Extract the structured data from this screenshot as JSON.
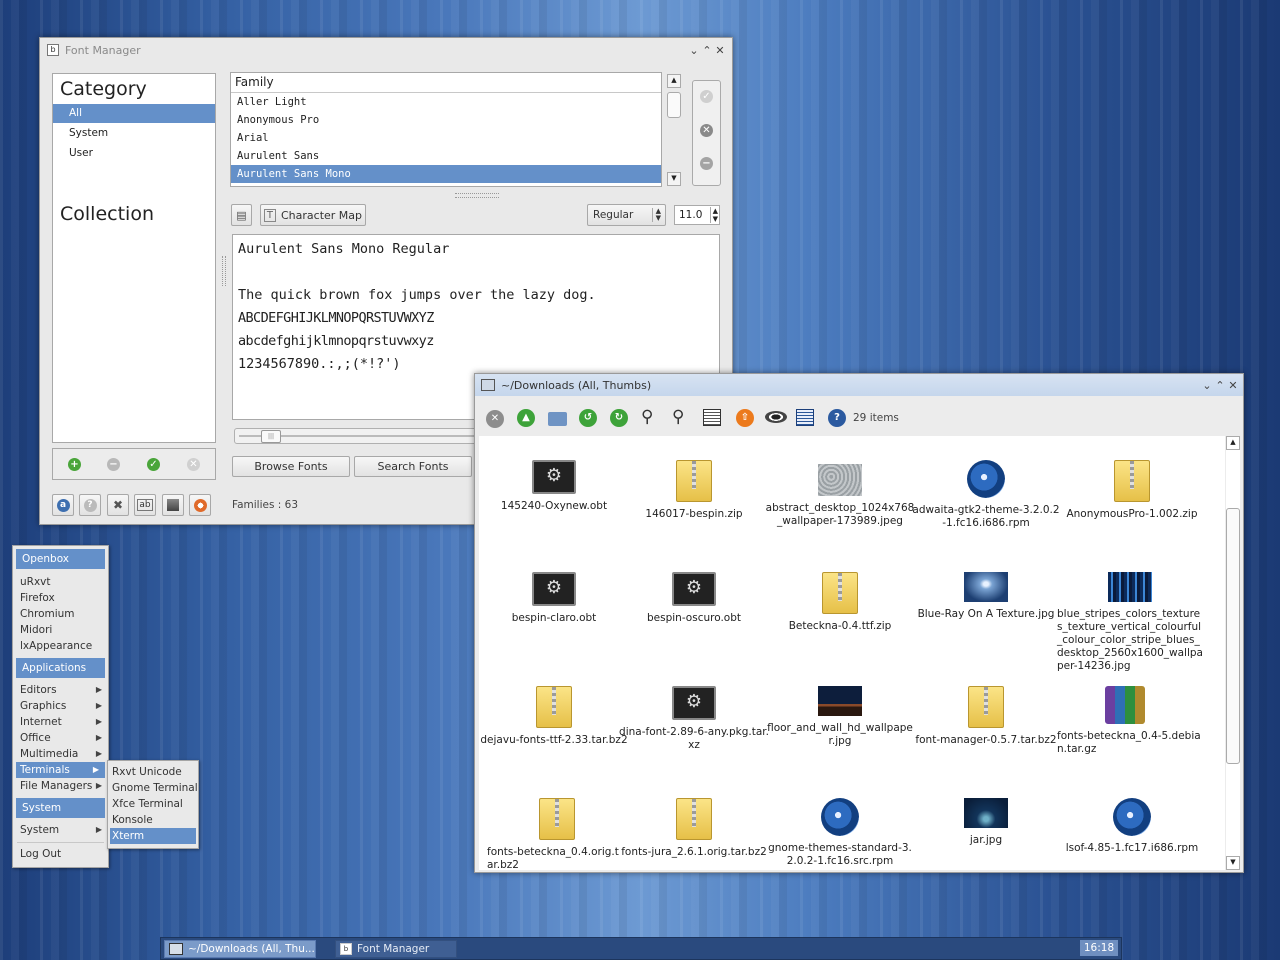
{
  "font_manager": {
    "title": "Font Manager",
    "category_header": "Category",
    "categories": [
      "All",
      "System",
      "User"
    ],
    "collection_header": "Collection",
    "family_header": "Family",
    "families": [
      "Aller Light",
      "Anonymous Pro",
      "Arial",
      "Aurulent Sans",
      "Aurulent Sans Mono"
    ],
    "character_map_label": "Character Map",
    "style_value": "Regular",
    "size_value": "11.0",
    "preview_title": "Aurulent Sans Mono Regular",
    "preview_lines": [
      "The quick brown fox jumps over the lazy dog.",
      "ABCDEFGHIJKLMNOPQRSTUVWXYZ",
      "abcdefghijklmnopqrstuvwxyz",
      "1234567890.:,;(*!?')"
    ],
    "browse_fonts_label": "Browse Fonts",
    "search_fonts_label": "Search Fonts",
    "families_count": "Families : 63"
  },
  "file_manager": {
    "title": "~/Downloads (All, Thumbs)",
    "items_count": "29 items",
    "files": [
      {
        "name": "145240-Oxynew.obt",
        "type": "obt"
      },
      {
        "name": "146017-bespin.zip",
        "type": "zip"
      },
      {
        "name": "abstract_desktop_1024x768_wallpaper-173989.jpeg",
        "type": "img-gray"
      },
      {
        "name": "adwaita-gtk2-theme-3.2.0.2-1.fc16.i686.rpm",
        "type": "rpm"
      },
      {
        "name": "AnonymousPro-1.002.zip",
        "type": "zip"
      },
      {
        "name": "bespin-claro.obt",
        "type": "obt"
      },
      {
        "name": "bespin-oscuro.obt",
        "type": "obt"
      },
      {
        "name": "Beteckna-0.4.ttf.zip",
        "type": "zip"
      },
      {
        "name": "Blue-Ray On A Texture.jpg",
        "type": "img-blue"
      },
      {
        "name": "blue_stripes_colors_textures_texture_vertical_colourful_colour_color_stripe_blues_desktop_2560x1600_wallpaper-14236.jpg",
        "type": "img-stripes"
      },
      {
        "name": "dejavu-fonts-ttf-2.33.tar.bz2",
        "type": "zip"
      },
      {
        "name": "dina-font-2.89-6-any.pkg.tar.xz",
        "type": "obt"
      },
      {
        "name": "floor_and_wall_hd_wallpaper.jpg",
        "type": "img-dark"
      },
      {
        "name": "font-manager-0.5.7.tar.bz2",
        "type": "zip"
      },
      {
        "name": "fonts-beteckna_0.4-5.debian.tar.gz",
        "type": "rar"
      },
      {
        "name": "fonts-beteckna_0.4.orig.tar.bz2",
        "type": "zip"
      },
      {
        "name": "fonts-jura_2.6.1.orig.tar.bz2",
        "type": "zip"
      },
      {
        "name": "gnome-themes-standard-3.2.0.2-1.fc16.src.rpm",
        "type": "rpm"
      },
      {
        "name": "jar.jpg",
        "type": "img-jar"
      },
      {
        "name": "lsof-4.85-1.fc17.i686.rpm",
        "type": "rpm"
      }
    ]
  },
  "menu": {
    "openbox_header": "Openbox",
    "top_items": [
      "uRxvt",
      "Firefox",
      "Chromium",
      "Midori",
      "lxAppearance"
    ],
    "applications_header": "Applications",
    "app_items": [
      "Editors",
      "Graphics",
      "Internet",
      "Office",
      "Multimedia",
      "Terminals",
      "File Managers"
    ],
    "system_header": "System",
    "system_items": [
      "System"
    ],
    "logout_label": "Log Out",
    "terminals_submenu": [
      "Rxvt Unicode",
      "Gnome Terminal",
      "Xfce Terminal",
      "Konsole",
      "Xterm"
    ]
  },
  "taskbar": {
    "tasks": [
      "~/Downloads (All, Thu...",
      "Font Manager"
    ],
    "clock": "16:18"
  }
}
